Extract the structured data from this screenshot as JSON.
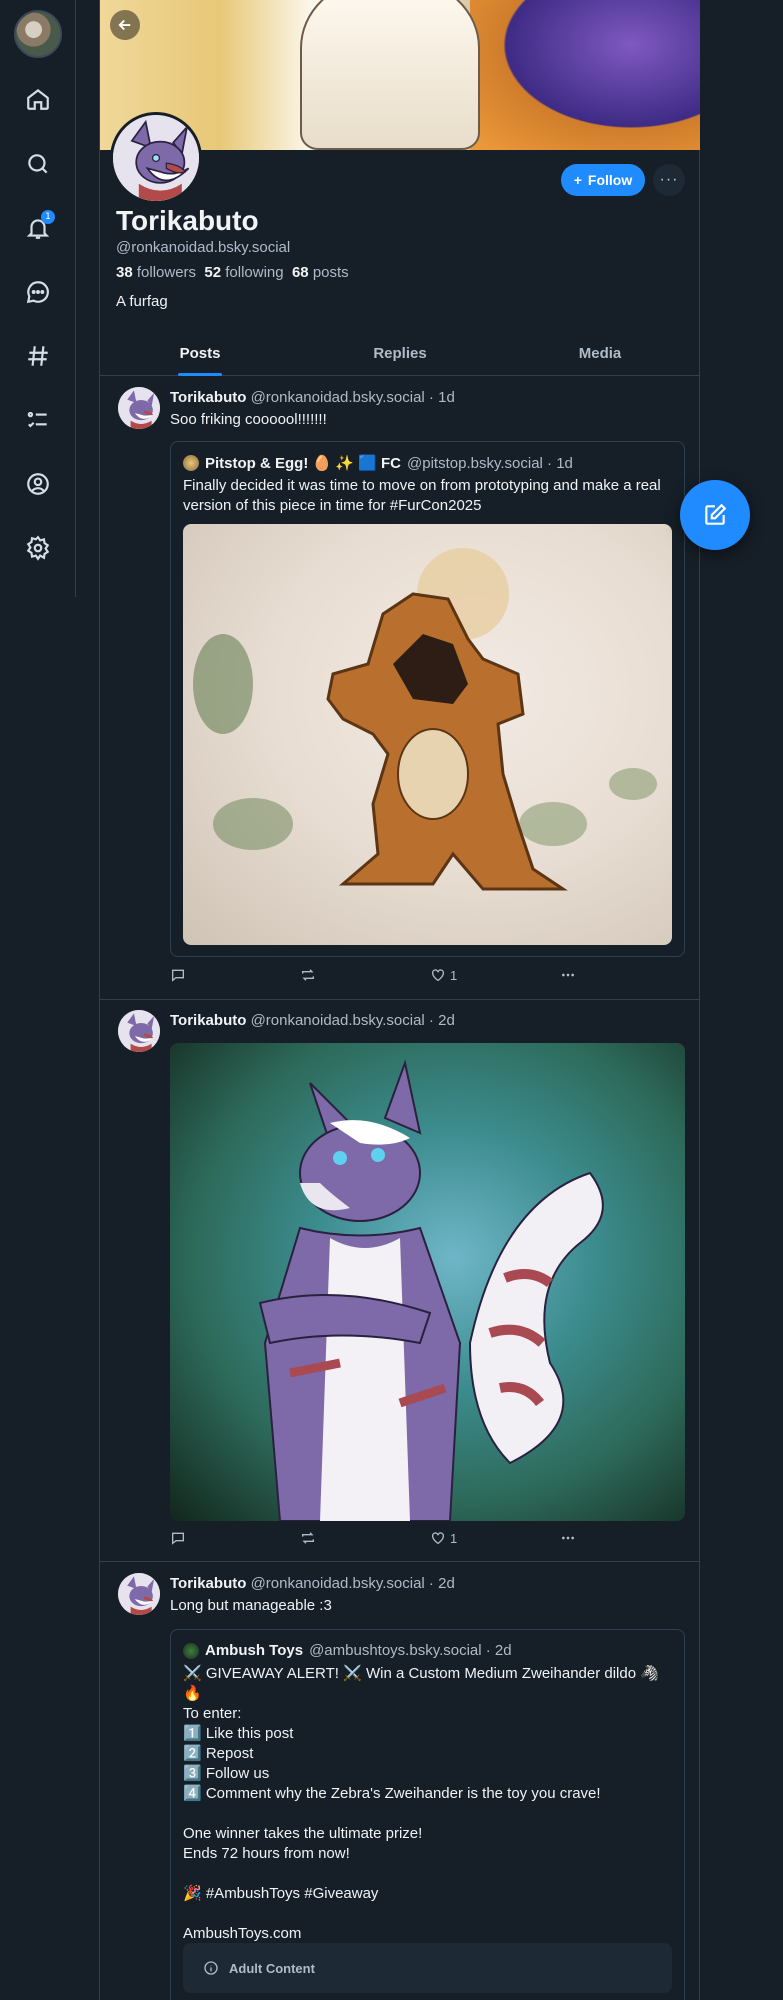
{
  "nav": {
    "items": [
      {
        "icon": "home-icon"
      },
      {
        "icon": "search-icon"
      },
      {
        "icon": "bell-icon",
        "badge": "1"
      },
      {
        "icon": "chat-icon"
      },
      {
        "icon": "hashtag-icon"
      },
      {
        "icon": "list-icon"
      },
      {
        "icon": "profile-icon"
      },
      {
        "icon": "settings-icon"
      }
    ]
  },
  "profile": {
    "display_name": "Torikabuto",
    "handle": "@ronkanoidad.bsky.social",
    "followers_count": "38",
    "followers_label": "followers",
    "following_count": "52",
    "following_label": "following",
    "posts_count": "68",
    "posts_label": "posts",
    "bio": "A furfag",
    "follow_label": "Follow",
    "more_label": "···"
  },
  "tabs": [
    {
      "label": "Posts",
      "active": true
    },
    {
      "label": "Replies",
      "active": false
    },
    {
      "label": "Media",
      "active": false
    }
  ],
  "posts": [
    {
      "author": "Torikabuto",
      "handle_time": "@ronkanoidad.bsky.social · 1d",
      "text": "Soo friking coooool!!!!!!!",
      "quote": {
        "author": "Pitstop & Egg! 🥚 ✨ 🟦 FC",
        "handle_time": "@pitstop.bsky.social · 1d",
        "text": "Finally decided it was time to move on from prototyping and make a real version of this piece in time for #FurCon2025"
      },
      "likes": "1"
    },
    {
      "author": "Torikabuto",
      "handle_time": "@ronkanoidad.bsky.social · 2d",
      "likes": "1"
    },
    {
      "author": "Torikabuto",
      "handle_time": "@ronkanoidad.bsky.social · 2d",
      "text": "Long but manageable :3",
      "quote": {
        "author": "Ambush Toys",
        "handle_time": "@ambushtoys.bsky.social · 2d",
        "text": "⚔️ GIVEAWAY ALERT! ⚔️ Win a Custom Medium Zweihander dildo 🦓🔥\nTo enter:\n1️⃣ Like this post\n2️⃣ Repost\n3️⃣ Follow us\n4️⃣ Comment why the Zebra's Zweihander is the toy you crave!\n\nOne winner takes the ultimate prize!\nEnds 72 hours from now!\n\n🎉 #AmbushToys #Giveaway\n\nAmbushToys.com",
        "adult_label": "Adult Content"
      }
    }
  ],
  "colors": {
    "accent": "#208bfe",
    "background": "#161e27",
    "border": "#2e4052"
  }
}
